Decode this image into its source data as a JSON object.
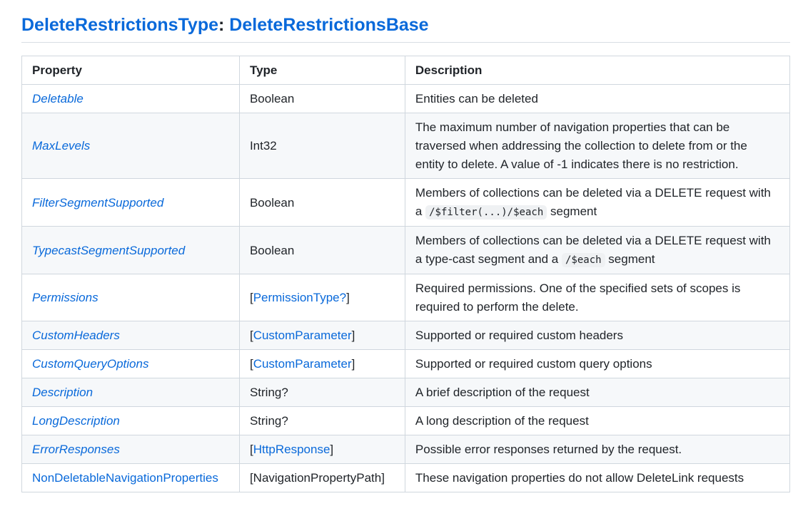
{
  "heading": {
    "type_name": "DeleteRestrictionsType",
    "separator": ":",
    "base_name": "DeleteRestrictionsBase"
  },
  "table": {
    "headers": [
      "Property",
      "Type",
      "Description"
    ],
    "rows": [
      {
        "property": "Deletable",
        "type": "Boolean",
        "type_is_link": false,
        "description": "Entities can be deleted"
      },
      {
        "property": "MaxLevels",
        "type": "Int32",
        "type_is_link": false,
        "description": "The maximum number of navigation properties that can be traversed when addressing the collection to delete from or the entity to delete. A value of -1 indicates there is no restriction."
      },
      {
        "property": "FilterSegmentSupported",
        "type": "Boolean",
        "type_is_link": false,
        "description_before": "Members of collections can be deleted via a DELETE request with a",
        "description_code": "/$filter(...)/$each",
        "description_after": "segment"
      },
      {
        "property": "TypecastSegmentSupported",
        "type": "Boolean",
        "type_is_link": false,
        "description_before": "Members of collections can be deleted via a DELETE request with a type-cast segment and a",
        "description_code": "/$each",
        "description_after": "segment"
      },
      {
        "property": "Permissions",
        "type_open": "[",
        "type_link": "PermissionType?",
        "type_close": "]",
        "type_is_link": true,
        "description": "Required permissions. One of the specified sets of scopes is required to perform the delete."
      },
      {
        "property": "CustomHeaders",
        "type_open": "[",
        "type_link": "CustomParameter",
        "type_close": "]",
        "type_is_link": true,
        "description": "Supported or required custom headers"
      },
      {
        "property": "CustomQueryOptions",
        "type_open": "[",
        "type_link": "CustomParameter",
        "type_close": "]",
        "type_is_link": true,
        "description": "Supported or required custom query options"
      },
      {
        "property": "Description",
        "type": "String?",
        "type_is_link": false,
        "description": "A brief description of the request"
      },
      {
        "property": "LongDescription",
        "type": "String?",
        "type_is_link": false,
        "description": "A long description of the request"
      },
      {
        "property": "ErrorResponses",
        "type_open": "[",
        "type_link": "HttpResponse",
        "type_close": "]",
        "type_is_link": true,
        "description": "Possible error responses returned by the request."
      },
      {
        "property": "NonDeletableNavigationProperties",
        "property_italic": false,
        "type": "[NavigationPropertyPath]",
        "type_is_link": false,
        "description": "These navigation properties do not allow DeleteLink requests"
      }
    ]
  },
  "colors": {
    "link": "#0969da",
    "text": "#1f2328",
    "border": "#d0d7de",
    "row_alt": "#f6f8fa"
  }
}
